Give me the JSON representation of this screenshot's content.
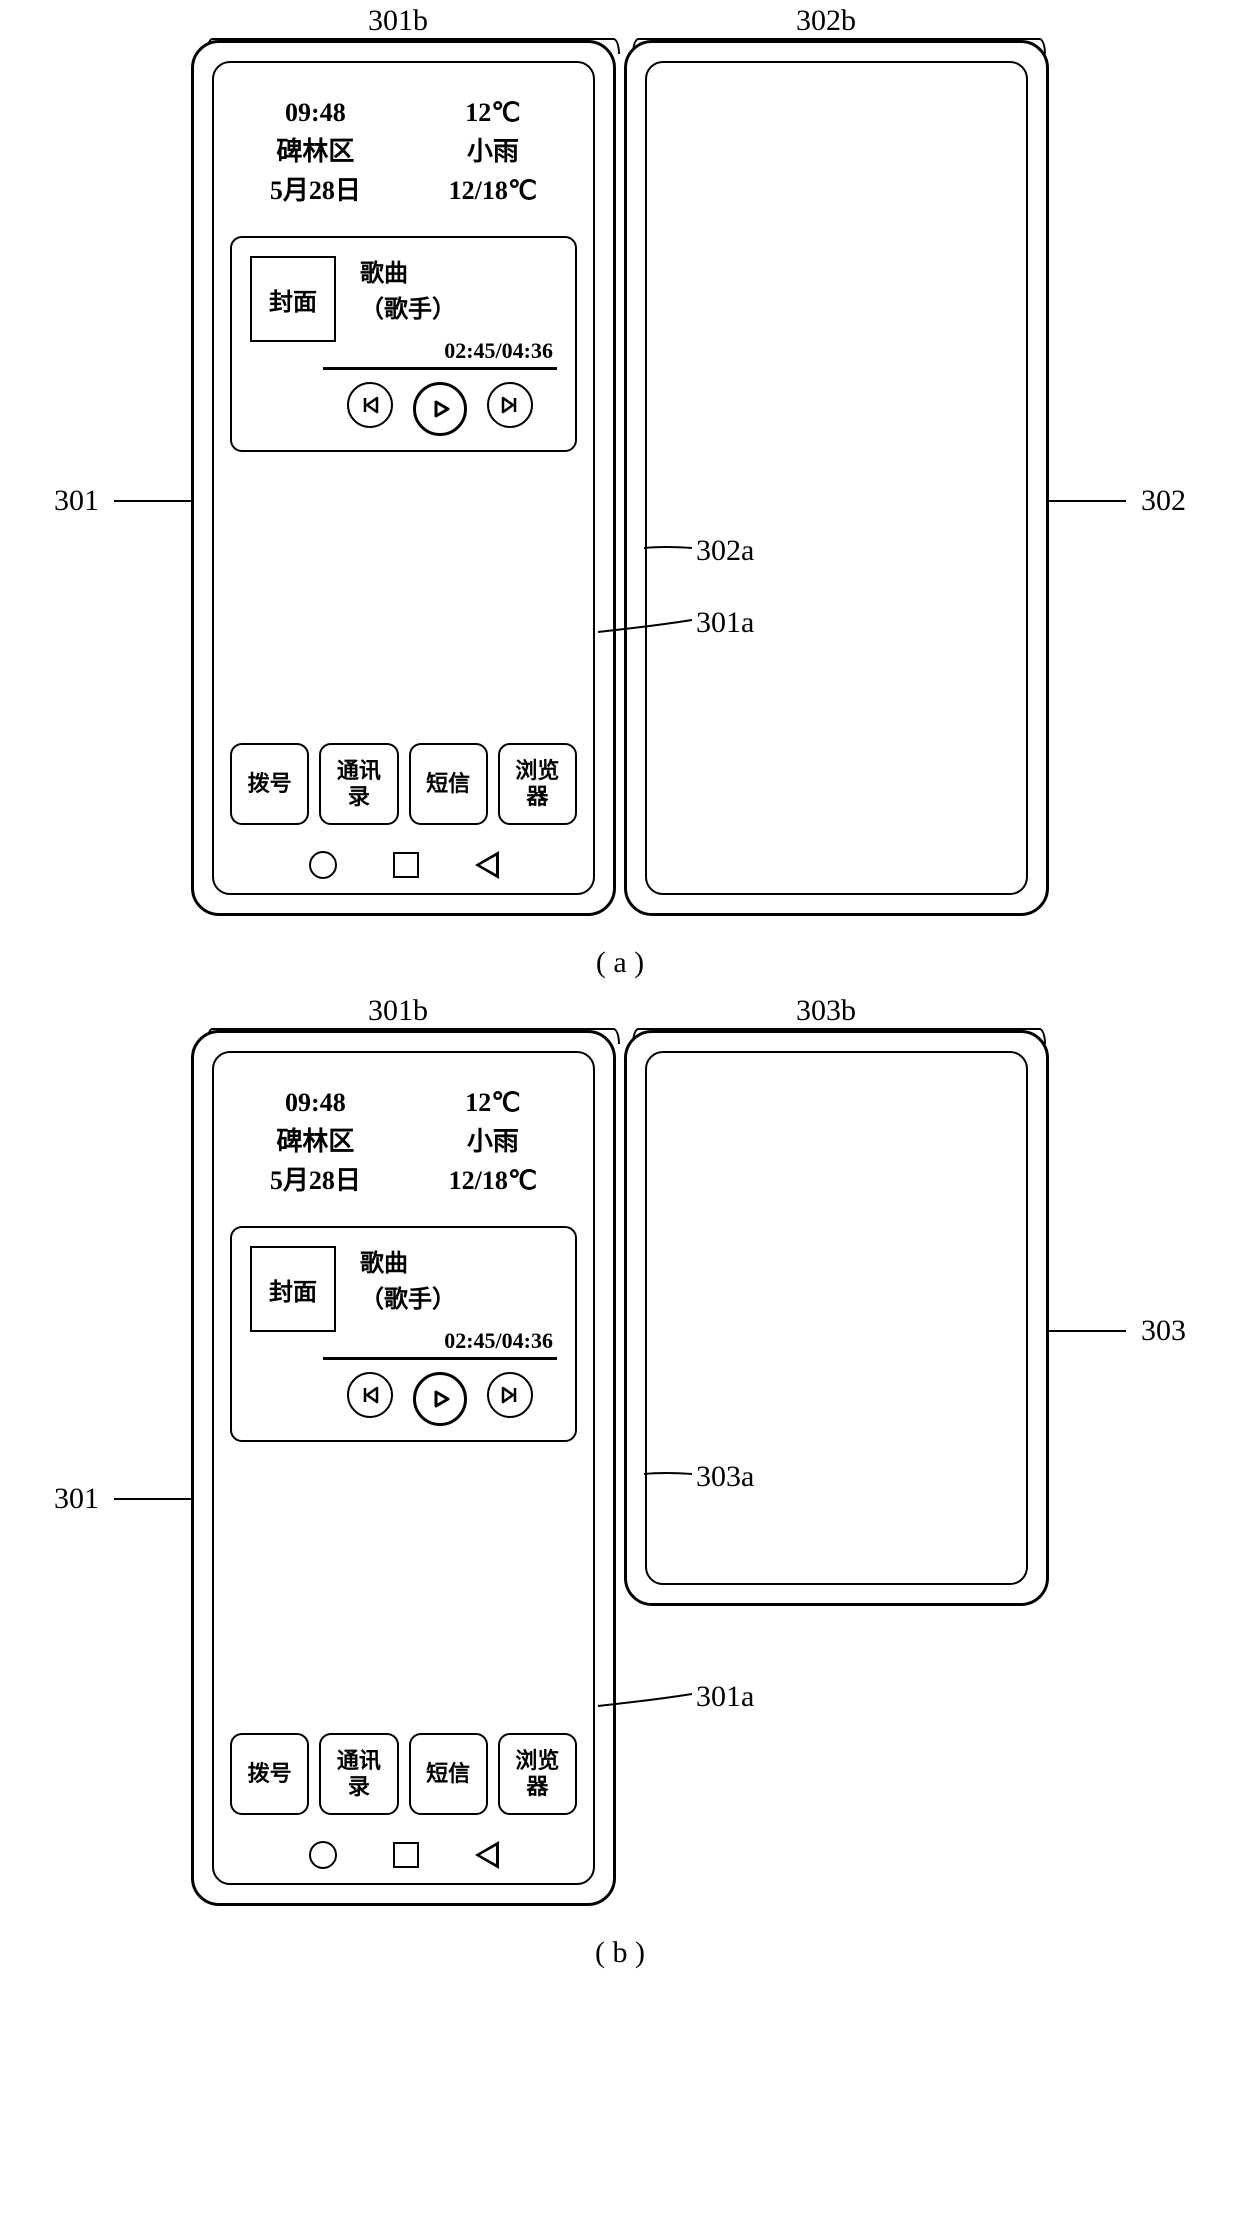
{
  "figure_a": {
    "caption": "( a )",
    "top_labels": {
      "left": "301b",
      "right": "302b"
    },
    "left_label": "301",
    "right_label": "302",
    "inner_labels": {
      "left": "301a",
      "right": "302a"
    }
  },
  "figure_b": {
    "caption": "( b )",
    "top_labels": {
      "left": "301b",
      "right": "303b"
    },
    "left_label": "301",
    "right_label": "303",
    "inner_labels": {
      "left": "301a",
      "right": "303a"
    }
  },
  "header": {
    "time": "09:48",
    "location": "碑林区",
    "date": "5月28日",
    "temp": "12℃",
    "weather": "小雨",
    "range": "12/18℃"
  },
  "music": {
    "cover": "封面",
    "song": "歌曲",
    "artist": "（歌手）",
    "time": "02:45/04:36"
  },
  "dock": {
    "app1": "拨号",
    "app2": "通讯\n录",
    "app3": "短信",
    "app4": "浏览\n器"
  }
}
